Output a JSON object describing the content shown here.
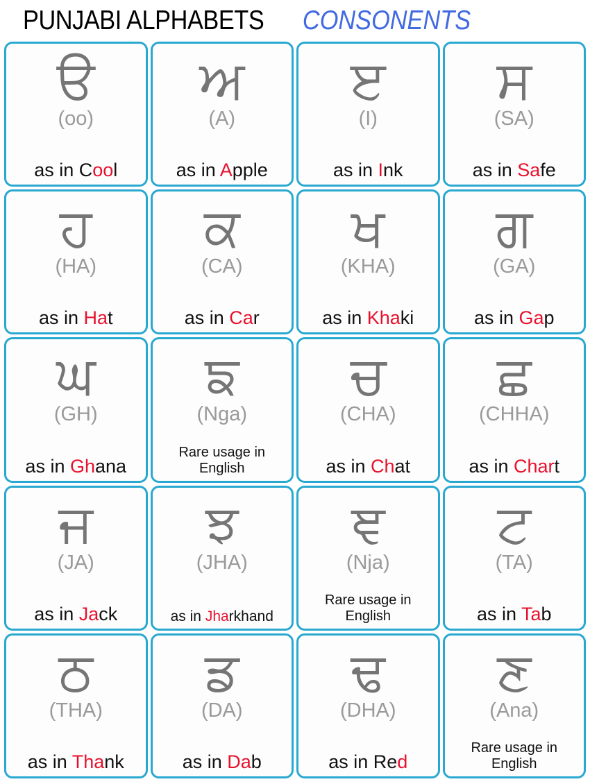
{
  "header": {
    "title_main": "PUNJABI ALPHABETS",
    "title_sub": "CONSONENTS",
    "title_main_color": "#000000",
    "title_sub_color": "#4169E1"
  },
  "theme": {
    "card_border": "#29a8d0",
    "glyph_color": "#757575",
    "roman_color": "#9a9a9a",
    "highlight_color": "#e8112d",
    "text_color": "#111111",
    "background": "#ffffff"
  },
  "cards": [
    {
      "glyph": "ੳ",
      "roman": "(oo)",
      "prefix": "as in C",
      "highlight": "oo",
      "suffix": "l",
      "size": "normal",
      "rare": null
    },
    {
      "glyph": "ਅ",
      "roman": "(A)",
      "prefix": "as in ",
      "highlight": "A",
      "suffix": "pple",
      "size": "normal",
      "rare": null
    },
    {
      "glyph": "ੲ",
      "roman": "(I)",
      "prefix": "as in ",
      "highlight": "I",
      "suffix": "nk",
      "size": "normal",
      "rare": null
    },
    {
      "glyph": "ਸ",
      "roman": "(SA)",
      "prefix": "as in ",
      "highlight": "Sa",
      "suffix": "fe",
      "size": "normal",
      "rare": null
    },
    {
      "glyph": "ਹ",
      "roman": "(HA)",
      "prefix": "as in ",
      "highlight": "Ha",
      "suffix": "t",
      "size": "normal",
      "rare": null
    },
    {
      "glyph": "ਕ",
      "roman": "(CA)",
      "prefix": "as in ",
      "highlight": "Ca",
      "suffix": "r",
      "size": "normal",
      "rare": null
    },
    {
      "glyph": "ਖ",
      "roman": "(KHA)",
      "prefix": "as in ",
      "highlight": "Kha",
      "suffix": "ki",
      "size": "normal",
      "rare": null
    },
    {
      "glyph": "ਗ",
      "roman": "(GA)",
      "prefix": "as in ",
      "highlight": "Ga",
      "suffix": "p",
      "size": "normal",
      "rare": null
    },
    {
      "glyph": "ਘ",
      "roman": "(GH)",
      "prefix": "as in ",
      "highlight": "Gh",
      "suffix": "ana",
      "size": "normal",
      "rare": null
    },
    {
      "glyph": "ਙ",
      "roman": "(Nga)",
      "prefix": null,
      "highlight": null,
      "suffix": null,
      "size": "normal",
      "rare": [
        "Rare usage in",
        "English"
      ]
    },
    {
      "glyph": "ਚ",
      "roman": "(CHA)",
      "prefix": "as in ",
      "highlight": "Ch",
      "suffix": "at",
      "size": "normal",
      "rare": null
    },
    {
      "glyph": "ਛ",
      "roman": "(CHHA)",
      "prefix": "as in ",
      "highlight": "Char",
      "suffix": "t",
      "size": "normal",
      "rare": null
    },
    {
      "glyph": "ਜ",
      "roman": "(JA)",
      "prefix": "as in ",
      "highlight": "Ja",
      "suffix": "ck",
      "size": "normal",
      "rare": null
    },
    {
      "glyph": "ਝ",
      "roman": "(JHA)",
      "prefix": "as in ",
      "highlight": "Jha",
      "suffix": "rkhand",
      "size": "small",
      "rare": null
    },
    {
      "glyph": "ਞ",
      "roman": "(Nja)",
      "prefix": null,
      "highlight": null,
      "suffix": null,
      "size": "normal",
      "rare": [
        "Rare usage in",
        "English"
      ]
    },
    {
      "glyph": "ਟ",
      "roman": "(TA)",
      "prefix": "as in ",
      "highlight": "Ta",
      "suffix": "b",
      "size": "normal",
      "rare": null
    },
    {
      "glyph": "ਠ",
      "roman": "(THA)",
      "prefix": "as in ",
      "highlight": "Tha",
      "suffix": "nk",
      "size": "normal",
      "rare": null
    },
    {
      "glyph": "ਡ",
      "roman": "(DA)",
      "prefix": "as in ",
      "highlight": "Da",
      "suffix": "b",
      "size": "normal",
      "rare": null
    },
    {
      "glyph": "ਢ",
      "roman": "(DHA)",
      "prefix": "as in Re",
      "highlight": "d",
      "suffix": "",
      "size": "normal",
      "rare": null
    },
    {
      "glyph": "ਣ",
      "roman": "(Ana)",
      "prefix": null,
      "highlight": null,
      "suffix": null,
      "size": "normal",
      "rare": [
        "Rare usage in",
        "English"
      ]
    }
  ]
}
